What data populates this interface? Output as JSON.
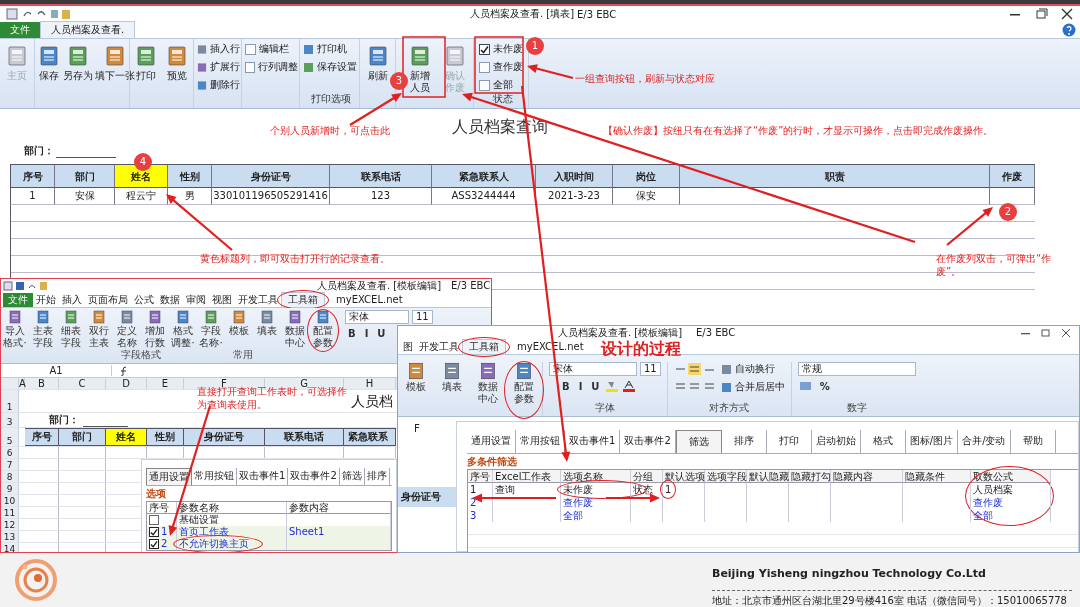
{
  "window": {
    "title": "人员档案及查看. [填表]",
    "app": "E/3 EBC"
  },
  "tabs": [
    {
      "label": "文件",
      "selected": false,
      "kind": "file"
    },
    {
      "label": "人员档案及查看.",
      "selected": true,
      "kind": "tab"
    }
  ],
  "ribbon": [
    {
      "items": [
        {
          "kind": "big",
          "label": "主页",
          "disabled": true
        }
      ]
    },
    {
      "items": [
        {
          "kind": "big",
          "label": "保存",
          "disabled": false
        },
        {
          "kind": "big",
          "label": "另存为",
          "disabled": false
        },
        {
          "kind": "big",
          "label": "填下一张",
          "disabled": false
        }
      ]
    },
    {
      "items": [
        {
          "kind": "big",
          "label": "打印",
          "disabled": false
        },
        {
          "kind": "big",
          "label": "预览",
          "disabled": false
        }
      ]
    },
    {
      "items": [
        {
          "kind": "small",
          "label": "插入行"
        },
        {
          "kind": "small",
          "label": "扩展行"
        },
        {
          "kind": "small",
          "label": "删除行"
        }
      ]
    },
    {
      "items": [
        {
          "kind": "check",
          "label": "编辑栏",
          "checked": false
        },
        {
          "kind": "check",
          "label": "行列调整",
          "checked": false
        }
      ]
    },
    {
      "label": "打印选项",
      "items": [
        {
          "kind": "small",
          "label": "打印机"
        },
        {
          "kind": "small",
          "label": "保存设置"
        }
      ]
    },
    {
      "items": [
        {
          "kind": "big",
          "label": "刷新",
          "disabled": false
        }
      ]
    },
    {
      "items": [
        {
          "kind": "stacked",
          "label": "新增人员",
          "disabled": false
        },
        {
          "kind": "stacked",
          "label": "确认作废",
          "disabled": true
        }
      ]
    },
    {
      "label": "状态",
      "items": [
        {
          "kind": "check",
          "label": "未作废",
          "checked": true
        },
        {
          "kind": "check",
          "label": "查作废",
          "checked": false
        },
        {
          "kind": "check",
          "label": "全部",
          "checked": false
        }
      ]
    }
  ],
  "page": {
    "title": "人员档案查询",
    "dept_label": "部门：",
    "columns": [
      {
        "label": "序号",
        "highlight": false
      },
      {
        "label": "部门",
        "highlight": false
      },
      {
        "label": "姓名",
        "highlight": true
      },
      {
        "label": "性别",
        "highlight": false
      },
      {
        "label": "身份证号",
        "highlight": false
      },
      {
        "label": "联系电话",
        "highlight": false
      },
      {
        "label": "紧急联系人",
        "highlight": false
      },
      {
        "label": "入职时间",
        "highlight": false
      },
      {
        "label": "岗位",
        "highlight": false
      },
      {
        "label": "职责",
        "highlight": false
      },
      {
        "label": "作废",
        "highlight": false
      }
    ],
    "rows": [
      [
        "1",
        "安保",
        "程云宁",
        "男",
        "330101196505291416",
        "123",
        "ASS3244444",
        "2021-3-23",
        "保安"
      ]
    ]
  },
  "excel_window": {
    "title": "人员档案及查看. [模板编辑]",
    "app": "E/3 EBC",
    "tabs": [
      {
        "label": "文件",
        "selected": false,
        "kind": "file"
      },
      {
        "label": "开始",
        "selected": false,
        "kind": "tab"
      },
      {
        "label": "插入",
        "selected": false,
        "kind": "tab"
      },
      {
        "label": "页面布局",
        "selected": false,
        "kind": "tab"
      },
      {
        "label": "公式",
        "selected": false,
        "kind": "tab"
      },
      {
        "label": "数据",
        "selected": false,
        "kind": "tab"
      },
      {
        "label": "审阅",
        "selected": false,
        "kind": "tab"
      },
      {
        "label": "视图",
        "selected": false,
        "kind": "tab"
      },
      {
        "label": "开发工具",
        "selected": false,
        "kind": "tab"
      },
      {
        "label": "工具箱",
        "selected": true,
        "kind": "tab"
      },
      {
        "label": "myEXCEL.net",
        "selected": false,
        "kind": "tab"
      }
    ],
    "ribbon_items": [
      "导入格式·",
      "主表字段",
      "细表字段",
      "双行主表",
      "定义名称",
      "增加行数",
      "格式调整·",
      "字段名称·",
      "模板",
      "填表",
      "数据中心",
      "配置参数"
    ],
    "group_labels": [
      "字段格式",
      "常用"
    ],
    "font": "宋体",
    "font_size": "11",
    "format_buttons": [
      "B",
      "I",
      "U"
    ],
    "name_box": "A1",
    "columns": [
      "A",
      "B",
      "C",
      "D",
      "E",
      "F",
      "G",
      "H"
    ],
    "row_numbers": [
      "1",
      "3",
      "5",
      "6",
      "7",
      "8",
      "9",
      "10",
      "11",
      "12",
      "13",
      "14"
    ],
    "sheet_title": "人员档",
    "dept_label": "部门：",
    "headers": [
      {
        "label": "序号",
        "highlight": false
      },
      {
        "label": "部门",
        "highlight": false
      },
      {
        "label": "姓名",
        "highlight": true
      },
      {
        "label": "性别",
        "highlight": false
      },
      {
        "label": "身份证号",
        "highlight": false
      },
      {
        "label": "联系电话",
        "highlight": false
      },
      {
        "label": "紧急联系",
        "highlight": false
      }
    ],
    "note": "直接打开查询工作表时，可选择作为查询表使用。"
  },
  "excel_window_2": {
    "title": "人员档案及查看. [模板编辑]",
    "app": "E/3 EBC",
    "tabs": [
      {
        "label": "图",
        "selected": false
      },
      {
        "label": "开发工具",
        "selected": false
      },
      {
        "label": "工具箱",
        "selected": true
      },
      {
        "label": "myEXCEL.net",
        "selected": false
      }
    ],
    "ribbon_items": [
      "模板",
      "填表",
      "数据中心",
      "配置参数"
    ],
    "font": "宋体",
    "font_size": "11",
    "format_buttons": [
      "B",
      "I",
      "U"
    ],
    "wrap_label": "自动换行",
    "merge_label": "合并后居中",
    "number_format": "常规",
    "percent": "%",
    "group_labels": [
      "字体",
      "对齐方式",
      "数字"
    ],
    "column": "F",
    "header_cell": "身份证号",
    "note": "设计的过程"
  },
  "dialog_options": {
    "tabs": [
      {
        "label": "通用设置",
        "selected": true
      },
      {
        "label": "常用按钮",
        "selected": false
      },
      {
        "label": "双击事件1",
        "selected": false
      },
      {
        "label": "双击事件2",
        "selected": false
      },
      {
        "label": "筛选",
        "selected": false
      },
      {
        "label": "排序",
        "selected": false
      }
    ],
    "section": "选项",
    "columns": [
      "序号",
      "参数名称",
      "参数内容"
    ],
    "rows": [
      {
        "checked": false,
        "name": "基础设置",
        "linked": false
      },
      {
        "checked": true,
        "no": "1",
        "name": "首页工作表",
        "value": "Sheet1",
        "linked": true
      },
      {
        "checked": true,
        "no": "2",
        "name": "不允许切换主页",
        "linked": true
      }
    ]
  },
  "dialog_filter": {
    "tabs": [
      {
        "label": "通用设置",
        "selected": false
      },
      {
        "label": "常用按钮",
        "selected": false
      },
      {
        "label": "双击事件1",
        "selected": false
      },
      {
        "label": "双击事件2",
        "selected": false
      },
      {
        "label": "筛选",
        "selected": true
      },
      {
        "label": "排序",
        "selected": false
      },
      {
        "label": "打印",
        "selected": false
      },
      {
        "label": "启动初始",
        "selected": false
      },
      {
        "label": "格式",
        "selected": false
      },
      {
        "label": "图标/图片",
        "selected": false
      },
      {
        "label": "合并/变动",
        "selected": false
      },
      {
        "label": "帮助",
        "selected": false
      }
    ],
    "section": "多条件筛选",
    "columns": [
      "序号",
      "Excel工作表",
      "选项名称",
      "分组",
      "默认选项",
      "选项字段",
      "默认隐藏",
      "隐藏打勾",
      "隐藏内容",
      "隐藏条件",
      "取数公式"
    ],
    "rows": [
      {
        "no": "1",
        "sheet": "查询",
        "option": "未作废",
        "group": "状态",
        "default": "1",
        "formula": "人员档案",
        "linked": false
      },
      {
        "no": "2",
        "option": "查作废",
        "formula": "查作废",
        "linked": true
      },
      {
        "no": "3",
        "option": "全部",
        "formula": "全部",
        "linked": true
      }
    ]
  },
  "annotations": [
    {
      "text": "一组查询按钮，刷新与状态对应"
    },
    {
      "text": "个别人员新增时，可点击此"
    },
    {
      "text": "【确认作废】按纽只有在有选择了“作废”的行时，才显示可操作，点击即完成作废操作。"
    },
    {
      "text": "黄色标题列，即可双击打开行的记录查看。"
    },
    {
      "text": "在作废列双击，可弹出“作废”。"
    }
  ],
  "badges": [
    "1",
    "2",
    "3",
    "4"
  ],
  "footer": {
    "company_en": "Beijing Yisheng ningzhou Technology Co.Ltd",
    "address": "地址：北京市通州区台湖北里29号楼416室  电话（微信同号）：15010065778"
  }
}
